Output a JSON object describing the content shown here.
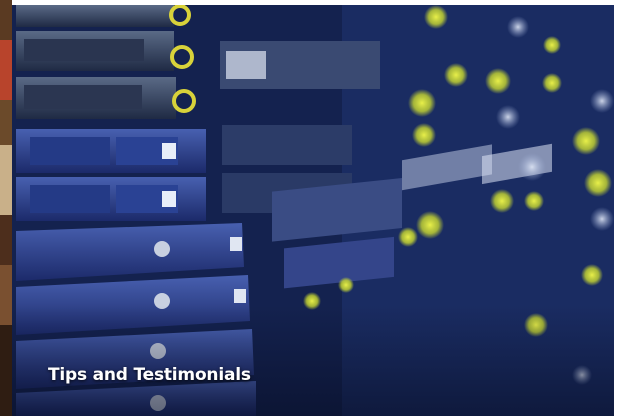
{
  "card": {
    "title": "Tips and Testimonials",
    "image_icon": "server-rack-photo"
  },
  "colors": {
    "background": "#ffffff",
    "card_dark": "#0c1434",
    "card_blue": "#2d4a8c",
    "light_yellow": "#d8e23a",
    "title_text": "#ffffff"
  }
}
